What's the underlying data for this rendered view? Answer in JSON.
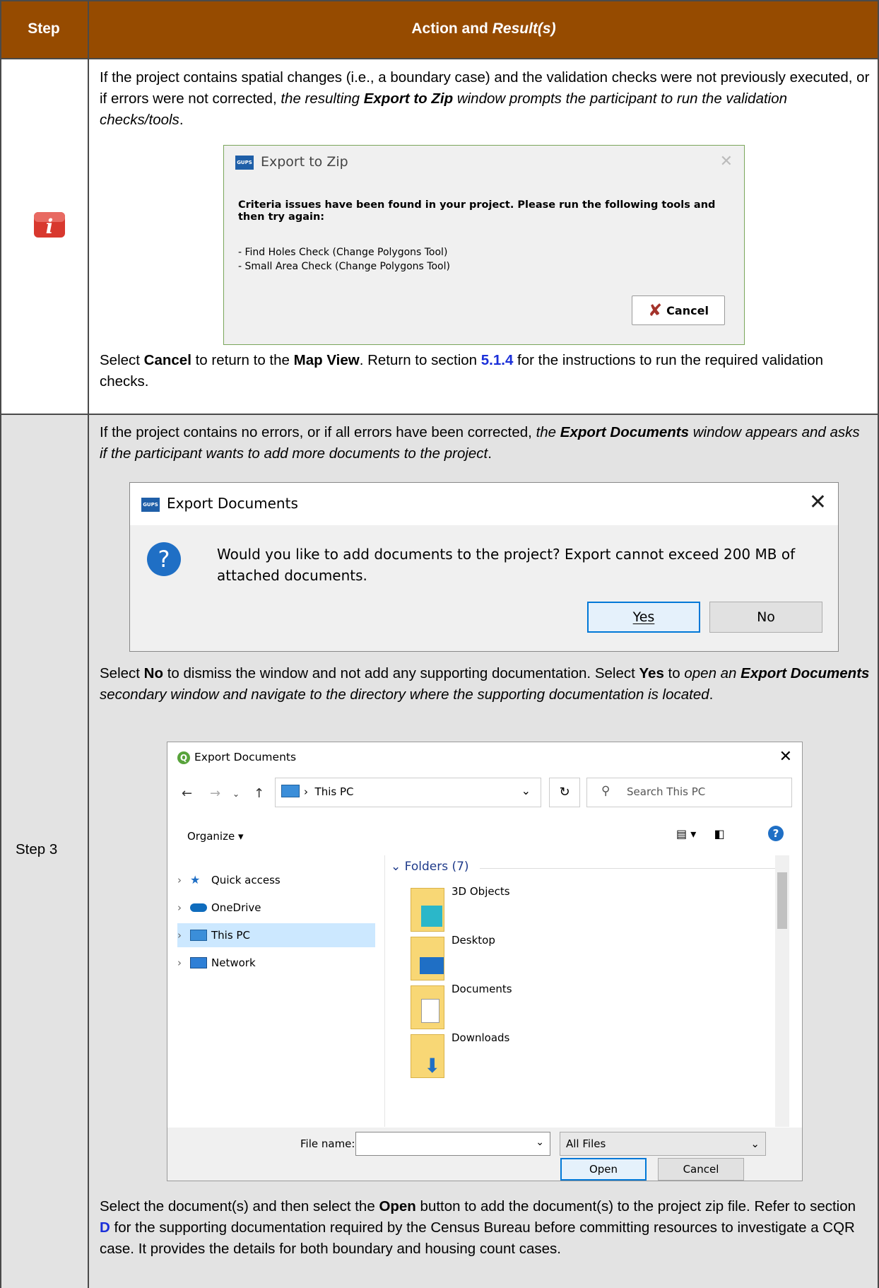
{
  "header": {
    "step": "Step",
    "action": "Action and ",
    "action_italic": "Result(s)"
  },
  "row1": {
    "p1_a": "If the project contains spatial changes (i.e., a boundary case) and the validation checks were not previously executed, or if errors were not corrected, ",
    "p1_i1": "the resulting ",
    "p1_bi": "Export to Zip",
    "p1_i2": " window prompts the participant to run the validation checks/tools",
    "p1_end": ".",
    "dialog": {
      "title": "Export to Zip",
      "app_icon_text": "GUPS",
      "message": "Criteria issues have been found in your project. Please run the following tools and then try again:",
      "items": [
        "- Find Holes Check (Change Polygons Tool)",
        "- Small Area Check (Change Polygons  Tool)"
      ],
      "cancel": "Cancel"
    },
    "p2_a": "Select ",
    "p2_b1": "Cancel",
    "p2_c": " to return to the ",
    "p2_b2": "Map View",
    "p2_d": ". Return to section ",
    "p2_link": "5.1.4",
    "p2_e": " for the instructions to run the required validation checks."
  },
  "row2": {
    "step_label": "Step 3",
    "p1_a": "If the project contains no errors, or if all errors have been corrected, ",
    "p1_i1": "the ",
    "p1_bi": "Export Documents",
    "p1_i2": " window appears and asks if the participant wants to add more documents to the project",
    "p1_end": ".",
    "dialog": {
      "title": "Export Documents",
      "app_icon_text": "GUPS",
      "message": "Would you like to add documents to the project? Export cannot exceed 200 MB of attached documents.",
      "yes": "Yes",
      "no": "No"
    },
    "p2_a": "Select ",
    "p2_b1": "No",
    "p2_c": " to dismiss the window and not add any supporting documentation. Select ",
    "p2_b2": "Yes",
    "p2_d": " to ",
    "p2_i1": "open an ",
    "p2_bi": "Export Documents",
    "p2_i2": " secondary window and navigate to the directory where the supporting documentation is located",
    "p2_end": ".",
    "file_dialog": {
      "title": "Export Documents",
      "path": "This PC",
      "search_placeholder": "Search This PC",
      "organize": "Organize ▾",
      "tree": [
        "Quick access",
        "OneDrive",
        "This PC",
        "Network"
      ],
      "folders_header": "Folders (7)",
      "folders": [
        "3D Objects",
        "Desktop",
        "Documents",
        "Downloads"
      ],
      "file_name_label": "File name:",
      "filter": "All Files",
      "open": "Open",
      "cancel": "Cancel"
    },
    "p3_a": "Select the document(s) and then select the ",
    "p3_b": "Open",
    "p3_c": " button to add the document(s) to the project zip file. Refer to section ",
    "p3_link": "D",
    "p3_d": " for the supporting documentation required by the Census Bureau before committing resources to investigate a CQR case. It provides the details for both boundary and housing count cases."
  },
  "colors": {
    "header_bg": "#964B00",
    "link": "#1a2fd9",
    "row2_bg": "#e3e3e3"
  }
}
